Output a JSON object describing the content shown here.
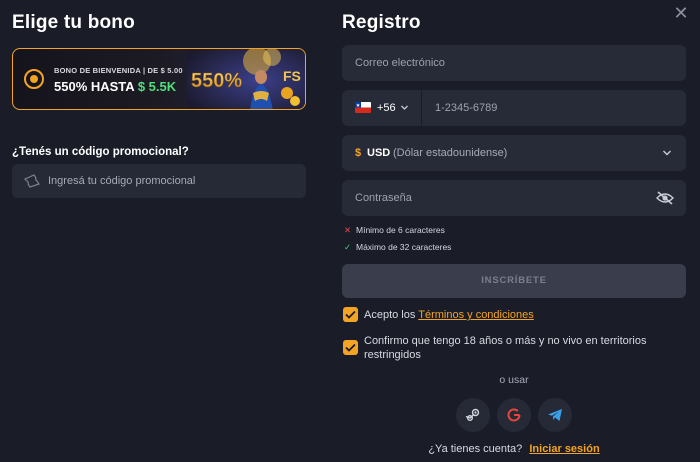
{
  "left": {
    "title": "Elige tu bono",
    "bonus": {
      "subtitle": "BONO DE BIENVENIDA | DE $ 5.00",
      "headline": "550% HASTA",
      "amount": "$ 5.5K",
      "art_text": "550%"
    },
    "promo": {
      "question": "¿Tenés un código promocional?",
      "placeholder": "Ingresá tu código promocional"
    }
  },
  "registration": {
    "title": "Registro",
    "email_placeholder": "Correo electrónico",
    "phone": {
      "dial_code": "+56",
      "placeholder": "1-2345-6789",
      "country_flag": "chile-flag"
    },
    "currency": {
      "symbol": "$",
      "code": "USD",
      "name": "(Dólar estadounidense)"
    },
    "password_placeholder": "Contraseña",
    "rules": [
      {
        "text": "Mínimo de 6 caracteres",
        "status": "fail"
      },
      {
        "text": "Máximo de 32 caracteres",
        "status": "pass"
      }
    ],
    "submit_label": "INSCRÍBETE",
    "terms": {
      "prefix": "Acepto los",
      "link": "Términos y condiciones",
      "checked": true
    },
    "age_confirm": {
      "text": "Confirmo que tengo 18 años o más y no vivo en territorios restringidos",
      "checked": true
    },
    "or_use": "o usar",
    "social": [
      "steam-icon",
      "google-icon",
      "telegram-icon"
    ],
    "login_prompt": "¿Ya tienes cuenta?",
    "login_link": "Iniciar sesión"
  },
  "colors": {
    "accent": "#f4a425",
    "background": "#1a1d28",
    "field": "#272a37",
    "success": "#4fe07a",
    "error": "#e64545"
  }
}
